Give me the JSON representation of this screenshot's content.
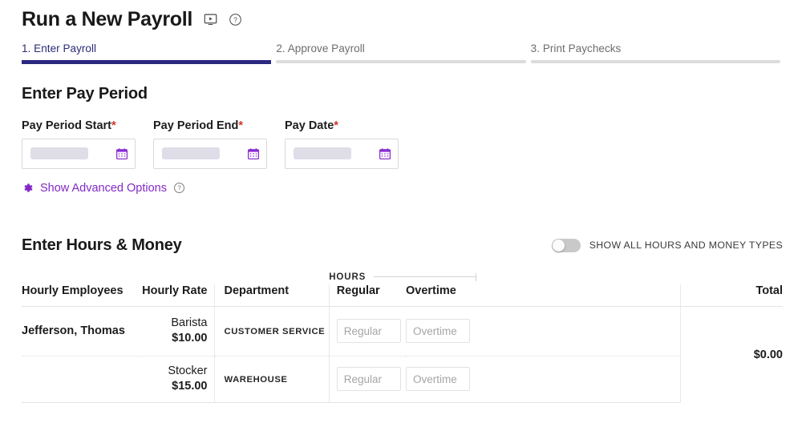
{
  "header": {
    "title": "Run a New Payroll",
    "video_icon": "video-tutorial-icon",
    "help_icon": "help-circle-icon"
  },
  "stepper": {
    "steps": [
      {
        "label": "1. Enter Payroll",
        "active": true
      },
      {
        "label": "2. Approve Payroll",
        "active": false
      },
      {
        "label": "3. Print Paychecks",
        "active": false
      }
    ],
    "active_color": "#2b2880",
    "inactive_color": "#dcdcdc"
  },
  "pay_period": {
    "section_title": "Enter Pay Period",
    "required_marker": "*",
    "fields": [
      {
        "label": "Pay Period Start",
        "value": "",
        "required": true,
        "icon": "calendar-icon"
      },
      {
        "label": "Pay Period End",
        "value": "",
        "required": true,
        "icon": "calendar-icon"
      },
      {
        "label": "Pay Date",
        "value": "",
        "required": true,
        "icon": "calendar-icon"
      }
    ],
    "advanced_options": {
      "label": "Show Advanced Options",
      "gear_icon": "gear-icon",
      "help_icon": "help-circle-icon",
      "color": "#8429c6"
    }
  },
  "hours_money": {
    "section_title": "Enter Hours & Money",
    "toggle": {
      "label": "SHOW ALL HOURS AND MONEY TYPES",
      "state": "off"
    },
    "table": {
      "group_header": "HOURS",
      "columns": [
        "Hourly Employees",
        "Hourly Rate",
        "Department",
        "Regular",
        "Overtime",
        "Total"
      ],
      "rows": [
        {
          "employee": "Jefferson, Thomas",
          "job_title": "Barista",
          "rate": "$10.00",
          "department": "CUSTOMER SERVICE",
          "regular_value": "",
          "regular_placeholder": "Regular",
          "overtime_value": "",
          "overtime_placeholder": "Overtime"
        },
        {
          "employee": "",
          "job_title": "Stocker",
          "rate": "$15.00",
          "department": "WAREHOUSE",
          "regular_value": "",
          "regular_placeholder": "Regular",
          "overtime_value": "",
          "overtime_placeholder": "Overtime"
        }
      ],
      "total": "$0.00"
    }
  }
}
